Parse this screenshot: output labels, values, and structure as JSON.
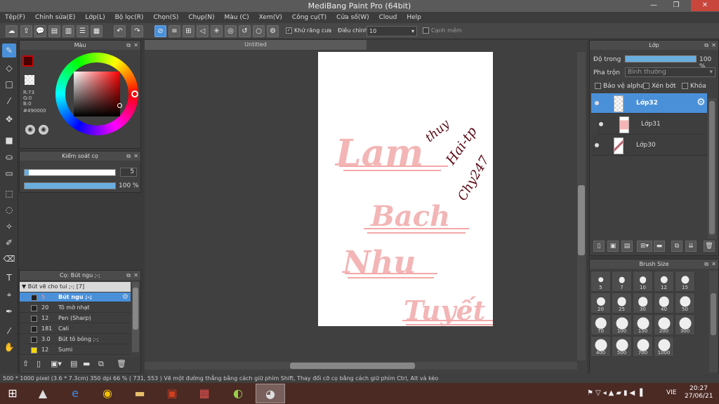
{
  "window": {
    "title": "MediBang Paint Pro (64bit)",
    "minimize": "—",
    "restore": "❐",
    "close": "✕"
  },
  "menu": [
    "Tệp(F)",
    "Chỉnh sửa(E)",
    "Lớp(L)",
    "Bộ lọc(R)",
    "Chọn(S)",
    "Chụp(N)",
    "Màu (C)",
    "Xem(V)",
    "Công cụ(T)",
    "Cửa số(W)",
    "Cloud",
    "Help"
  ],
  "toolbar": {
    "antialias_label": "Khử răng cưa",
    "adjust_label": "Điều chỉnh",
    "adjust_value": "10",
    "smooth_label": "Cạnh mềm"
  },
  "color_panel": {
    "title": "Màu",
    "r": "R:73",
    "g": "G:0",
    "b": "B:0",
    "hex": "#490000",
    "primary": "#490000"
  },
  "brush_control": {
    "title": "Kiểm soát cọ",
    "size_value": "5",
    "opacity_value": "100 %",
    "opacity_fill": 1.0,
    "size_fill": 0.05
  },
  "brush_panel": {
    "title": "Cọ: Bút ngu ;-;",
    "group": "Bút vẽ cho tui ;-; [7]",
    "items": [
      {
        "size": "5",
        "name": "Bút ngu ;-;",
        "color": "#222",
        "selected": true
      },
      {
        "size": "20",
        "name": "Tô mờ nhạt",
        "color": "#222"
      },
      {
        "size": "12",
        "name": "Pen (Sharp)",
        "color": "#222"
      },
      {
        "size": "181",
        "name": "Cali",
        "color": "#222"
      },
      {
        "size": "3.0",
        "name": "Bút tô bóng ;-;",
        "color": "#222"
      },
      {
        "size": "12",
        "name": "Sumi",
        "color": "#f5d800"
      }
    ]
  },
  "document": {
    "tab": "Untitled"
  },
  "artwork": {
    "words": [
      "Lam",
      "Bach",
      "Nhu",
      "Tuyết"
    ],
    "signature_lines": [
      "thuy",
      "Hai-tp",
      "Chy247"
    ]
  },
  "layers_panel": {
    "title": "Lớp",
    "opacity_label": "Độ trong",
    "opacity_value": "100 %",
    "blend_label": "Pha trộn",
    "blend_value": "Bình thường",
    "protect_alpha": "Bảo vệ alpha",
    "clipping": "Xén bớt",
    "lock": "Khóa",
    "layers": [
      {
        "name": "Lớp32",
        "selected": true
      },
      {
        "name": "Lớp31",
        "selected": false
      },
      {
        "name": "Lớp30",
        "selected": false
      }
    ]
  },
  "brush_size": {
    "title": "Brush Size",
    "sizes": [
      "5",
      "7",
      "10",
      "12",
      "15",
      "20",
      "25",
      "30",
      "40",
      "50",
      "70",
      "100",
      "150",
      "200",
      "300",
      "400",
      "500",
      "700",
      "1000"
    ]
  },
  "status": {
    "text": "500 * 1000 pixel   (3.6 * 7.3cm)   350 dpi   66 %   ( 731, 553 )   Vẽ một đường thẳng bằng cách giữ phím Shift, Thay đổi cỡ cọ bằng cách giữ phím Ctrl, Alt và kéo"
  },
  "taskbar": {
    "lang": "VIE",
    "time": "20:27",
    "date": "27/06/21"
  }
}
